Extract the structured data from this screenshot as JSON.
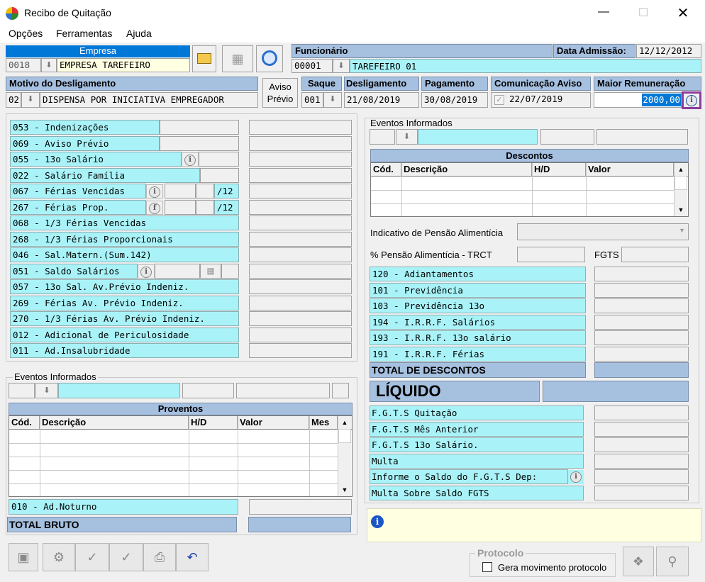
{
  "window": {
    "title": "Recibo de Quitação"
  },
  "menu": [
    "Opções",
    "Ferramentas",
    "Ajuda"
  ],
  "empresa": {
    "label": "Empresa",
    "code": "0018",
    "name": "EMPRESA TAREFEIRO"
  },
  "funcionario": {
    "label": "Funcionário",
    "code": "00001",
    "name": "TAREFEIRO 01"
  },
  "admissao": {
    "label": "Data Admissão:",
    "value": "12/12/2012"
  },
  "motivo": {
    "label": "Motivo do Desligamento",
    "code": "02",
    "value": "DISPENSA POR INICIATIVA EMPREGADOR"
  },
  "aviso_previo": {
    "line1": "Aviso",
    "line2": "Prévio"
  },
  "saque": {
    "label": "Saque",
    "value": "001"
  },
  "desligamento": {
    "label": "Desligamento",
    "value": "21/08/2019"
  },
  "pagamento": {
    "label": "Pagamento",
    "value": "30/08/2019"
  },
  "comunicacao": {
    "label": "Comunicação Aviso",
    "value": "22/07/2019"
  },
  "maior_remuneracao": {
    "label": "Maior Remuneração",
    "value": "2000,00"
  },
  "proventos_items": [
    "053 - Indenizações",
    "069 - Aviso Prévio",
    "055 - 13o Salário",
    "022 - Salário Família",
    "067 - Férias Vencidas",
    "267 - Férias Prop.",
    "068 - 1/3 Férias Vencidas",
    "268 - 1/3 Férias Proporcionais",
    "046 - Sal.Matern.(Sum.142)",
    "051 - Saldo Salários",
    "057 - 13o Sal. Av.Prévio Indeniz.",
    "269 - Férias  Av. Prévio Indeniz.",
    "270 - 1/3 Férias Av. Prévio Indeniz.",
    "012 - Adicional de Periculosidade",
    "011 - Ad.Insalubridade"
  ],
  "ferias_suffix": "/12",
  "eventos_label": "Eventos Informados",
  "proventos_grid": {
    "title": "Proventos",
    "columns": [
      "Cód.",
      "Descrição",
      "H/D",
      "Valor",
      "Mes"
    ]
  },
  "noturno": "010 - Ad.Noturno",
  "total_bruto": "TOTAL BRUTO",
  "descontos_grid": {
    "title": "Descontos",
    "columns": [
      "Cód.",
      "Descrição",
      "H/D",
      "Valor"
    ]
  },
  "pensao_indicativo": "Indicativo de Pensão Alimentícia",
  "pensao_pct": "% Pensão Alimentícia - TRCT",
  "fgts_label": "FGTS",
  "descontos_items": [
    "120 - Adiantamentos",
    "101 - Previdência",
    "103 - Previdência 13o",
    "194 - I.R.R.F. Salários",
    "193 - I.R.R.F. 13o salário",
    "191 - I.R.R.F. Férias"
  ],
  "total_descontos": "TOTAL DE DESCONTOS",
  "liquido": "LÍQUIDO",
  "fgts_items": [
    "F.G.T.S  Quitação",
    "F.G.T.S  Mês Anterior",
    "F.G.T.S  13o Salário.",
    "Multa",
    "Informe o Saldo do F.G.T.S Dep:",
    "Multa Sobre Saldo FGTS"
  ],
  "protocolo": {
    "legend": "Protocolo",
    "checkbox_label": "Gera movimento protocolo"
  },
  "colors": {
    "accent": "#0078d7",
    "cyan": "#a9f3f8",
    "header": "#a6c0e0",
    "highlight": "#8e3c9e"
  }
}
